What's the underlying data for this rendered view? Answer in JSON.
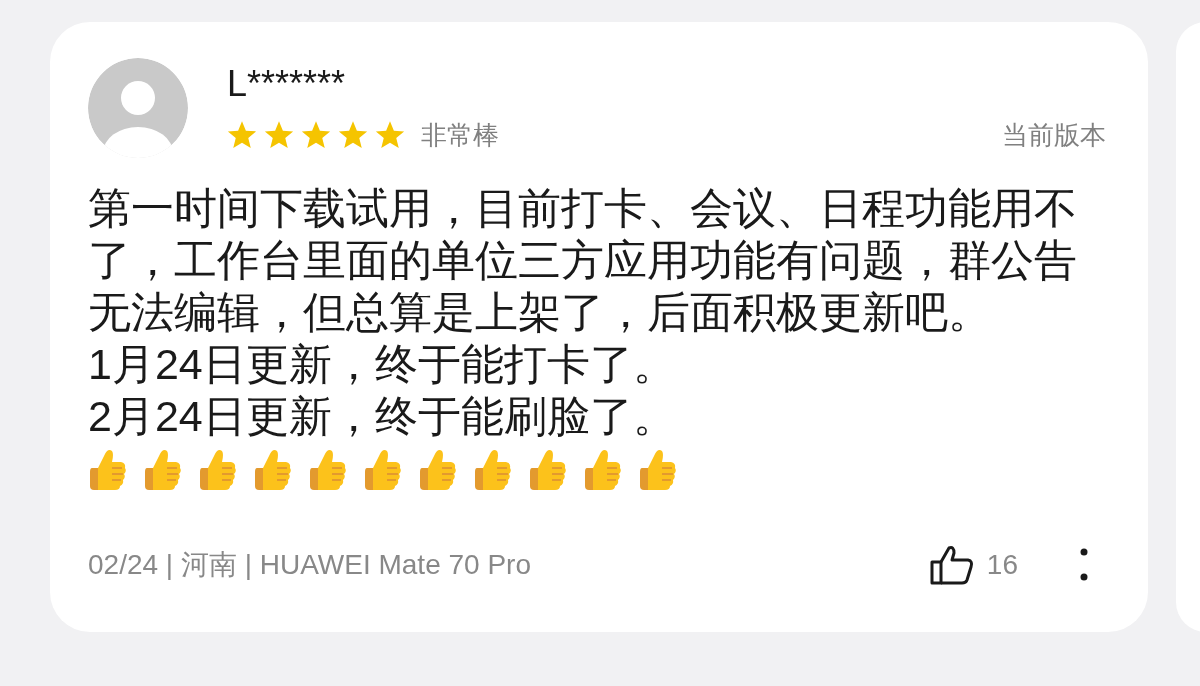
{
  "review": {
    "user": "L*******",
    "stars": 5,
    "rating_label": "非常棒",
    "version_tag": "当前版本",
    "paragraphs": [
      "第一时间下载试用，目前打卡、会议、日程功能用不了，工作台里面的单位三方应用功能有问题，群公告无法编辑，但总算是上架了，后面积极更新吧。",
      "1月24日更新，终于能打卡了。",
      "2月24日更新，终于能刷脸了。"
    ],
    "emoji": [
      {
        "kind": "thumbs-up"
      },
      {
        "kind": "thumbs-up"
      },
      {
        "kind": "thumbs-up"
      },
      {
        "kind": "thumbs-up"
      },
      {
        "kind": "thumbs-up"
      },
      {
        "kind": "thumbs-up"
      },
      {
        "kind": "thumbs-up"
      },
      {
        "kind": "thumbs-up"
      },
      {
        "kind": "thumbs-up"
      },
      {
        "kind": "thumbs-up"
      },
      {
        "kind": "thumbs-up"
      }
    ],
    "meta": "02/24 | 河南 | HUAWEI Mate 70 Pro",
    "likes": "16"
  }
}
